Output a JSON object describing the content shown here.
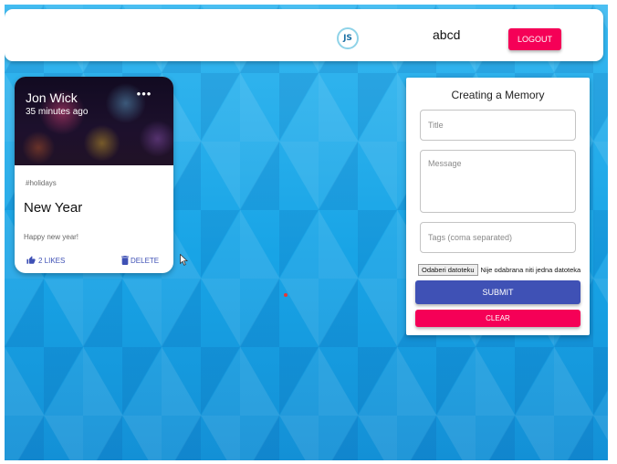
{
  "appbar": {
    "logo_text": "JS",
    "username": "abcd",
    "logout_label": "LOGOUT"
  },
  "post": {
    "author": "Jon Wick",
    "time": "35 minutes ago",
    "more_label": "•••",
    "tags": "#holidays",
    "title": "New Year",
    "message": "Happy new year!",
    "likes_label": "2 LIKES",
    "delete_label": "DELETE"
  },
  "form": {
    "heading": "Creating a Memory",
    "title_placeholder": "Title",
    "message_placeholder": "Message",
    "tags_placeholder": "Tags (coma separated)",
    "file_button_label": "Odaberi datoteku",
    "file_status": "Nije odabrana niti jedna datoteka",
    "submit_label": "SUBMIT",
    "clear_label": "CLEAR"
  },
  "colors": {
    "primary": "#3f51b5",
    "secondary": "#f50057",
    "background": "#1ea8e8"
  },
  "icons": {
    "logo": "js-logo-icon",
    "more": "more-horiz-icon",
    "like": "thumb-up-icon",
    "delete": "delete-icon",
    "cursor": "mouse-cursor-icon"
  }
}
